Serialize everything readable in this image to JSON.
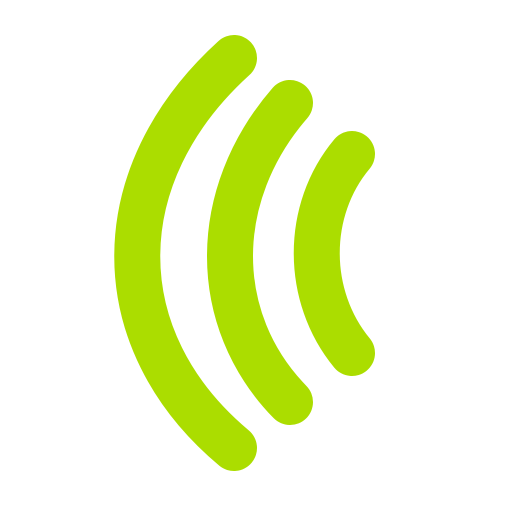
{
  "icon": {
    "name": "signal-waves-icon",
    "color": "#ABDD00",
    "arc_count": 3
  },
  "background": "#ffffff"
}
